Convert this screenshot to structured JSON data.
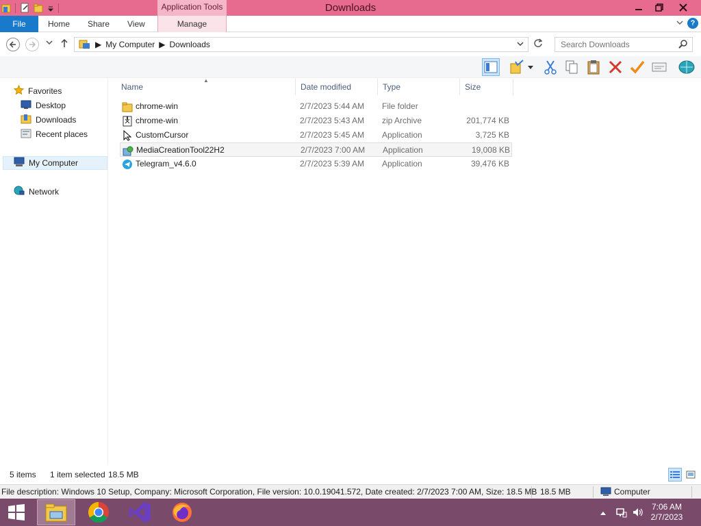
{
  "window": {
    "title": "Downloads",
    "contextual_tab": "Application Tools",
    "controls": [
      "minimize",
      "restore",
      "close"
    ],
    "accent": "#e76b8e"
  },
  "ribbon": {
    "file": "File",
    "tabs": [
      "Home",
      "Share",
      "View"
    ],
    "manage": "Manage"
  },
  "address": {
    "crumbs": [
      "My Computer",
      "Downloads"
    ],
    "search_placeholder": "Search Downloads"
  },
  "nav": {
    "favorites": "Favorites",
    "favorites_items": [
      "Desktop",
      "Downloads",
      "Recent places"
    ],
    "computer": "My Computer",
    "network": "Network"
  },
  "list": {
    "columns": [
      "Name",
      "Date modified",
      "Type",
      "Size"
    ],
    "rows": [
      {
        "name": "chrome-win",
        "date": "2/7/2023 5:44 AM",
        "type": "File folder",
        "size": "",
        "icon": "folder-icon"
      },
      {
        "name": "chrome-win",
        "date": "2/7/2023 5:43 AM",
        "type": "zip Archive",
        "size": "201,774 KB",
        "icon": "zip-archive-icon"
      },
      {
        "name": "CustomCursor",
        "date": "2/7/2023 5:45 AM",
        "type": "Application",
        "size": "3,725 KB",
        "icon": "cursor-app-icon"
      },
      {
        "name": "MediaCreationTool22H2",
        "date": "2/7/2023 7:00 AM",
        "type": "Application",
        "size": "19,008 KB",
        "icon": "media-creation-icon",
        "selected": true
      },
      {
        "name": "Telegram_v4.6.0",
        "date": "2/7/2023 5:39 AM",
        "type": "Application",
        "size": "39,476 KB",
        "icon": "telegram-icon"
      }
    ]
  },
  "status": {
    "count": "5 items",
    "selection": "1 item selected",
    "selection_size": "18.5 MB"
  },
  "details": {
    "description": "File description: Windows 10 Setup, Company: Microsoft Corporation, File version: 10.0.19041.572, Date created: 2/7/2023 7:00 AM, Size: 18.5 MB",
    "size": "18.5 MB",
    "location": "Computer"
  },
  "taskbar": {
    "apps": [
      "file-explorer",
      "chrome",
      "visual-studio",
      "firefox"
    ],
    "time": "7:06 AM",
    "date": "2/7/2023"
  }
}
